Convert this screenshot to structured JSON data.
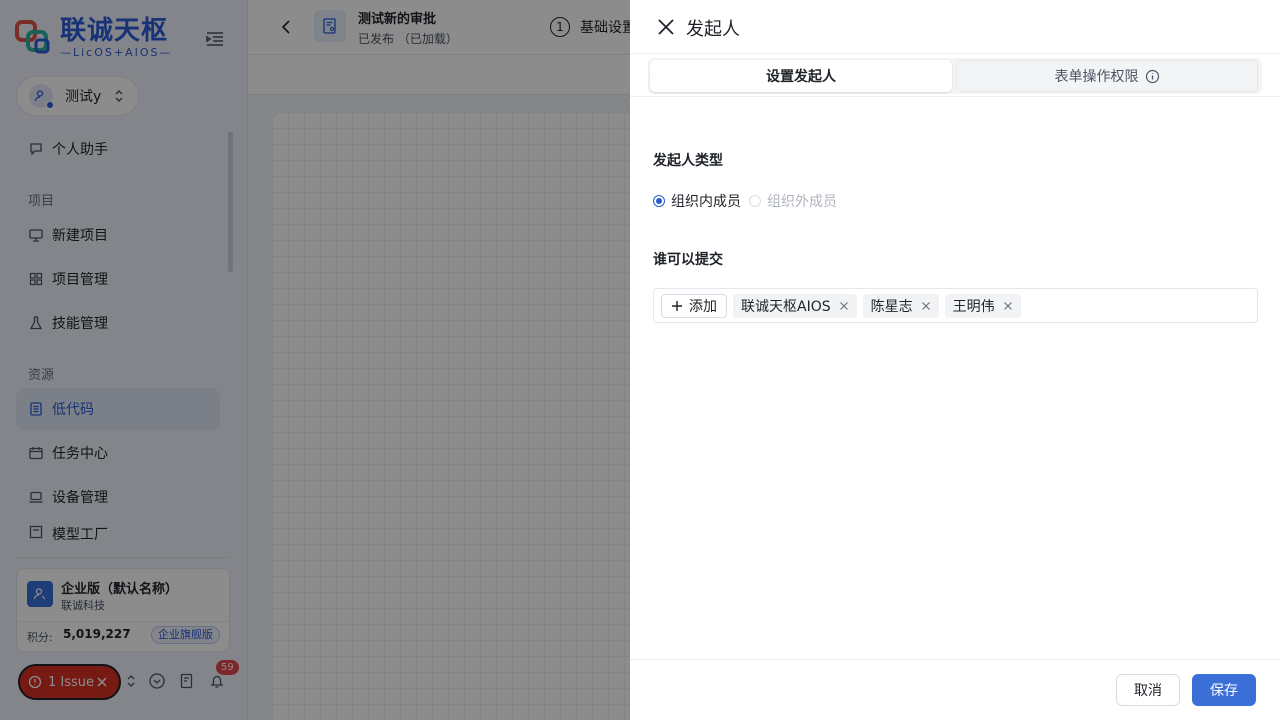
{
  "colors": {
    "accent": "#3a6fd8",
    "brand": "#2a5bd7",
    "danger": "#d93026"
  },
  "sidebar": {
    "logo_title": "联诚天枢",
    "logo_sub": "—LicOS+AIOS—",
    "workspace": "测试y",
    "items": [
      {
        "label": "个人助手",
        "icon": "chat-icon"
      },
      {
        "label": "新建项目",
        "icon": "monitor-icon"
      },
      {
        "label": "项目管理",
        "icon": "grid-icon"
      },
      {
        "label": "技能管理",
        "icon": "flask-icon"
      },
      {
        "label": "低代码",
        "icon": "document-icon"
      },
      {
        "label": "任务中心",
        "icon": "calendar-icon"
      },
      {
        "label": "设备管理",
        "icon": "laptop-icon"
      },
      {
        "label": "模型工厂",
        "icon": "factory-icon"
      }
    ],
    "sections": {
      "project": "项目",
      "resource": "资源"
    },
    "org": {
      "name": "企业版（默认名称）",
      "company": "联诚科技",
      "points_label": "积分:",
      "points": "5,019,227",
      "badge": "企业旗舰版"
    },
    "issue": "1 Issue",
    "notify_count": "59"
  },
  "topbar": {
    "title": "测试新的审批",
    "status": "已发布 （已加载）",
    "step_num": "1",
    "step_label": "基础设置"
  },
  "drawer": {
    "title": "发起人",
    "tabs": [
      {
        "label": "设置发起人",
        "active": true
      },
      {
        "label": "表单操作权限",
        "active": false
      }
    ],
    "initiator_type_title": "发起人类型",
    "radios": [
      {
        "label": "组织内成员",
        "checked": true
      },
      {
        "label": "组织外成员",
        "checked": false
      }
    ],
    "who_can_submit_title": "谁可以提交",
    "add_label": "添加",
    "members": [
      "联诚天枢AIOS",
      "陈星志",
      "王明伟"
    ],
    "cancel_label": "取消",
    "save_label": "保存"
  }
}
